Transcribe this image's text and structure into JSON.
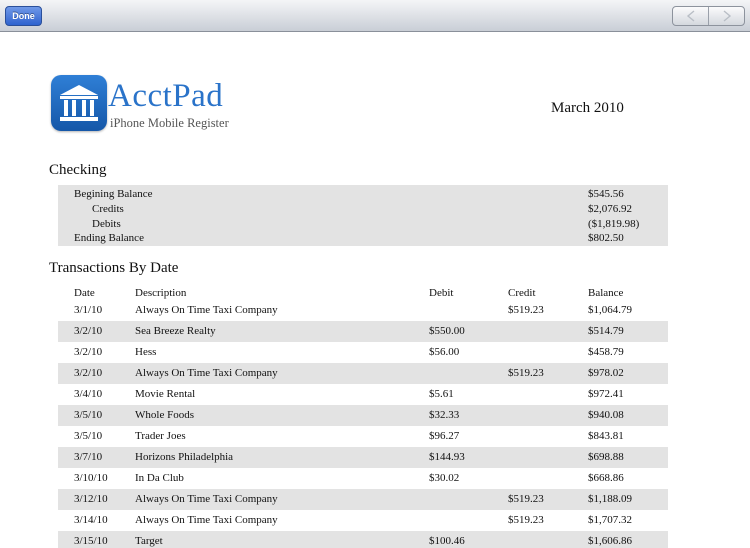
{
  "toolbar": {
    "done_label": "Done",
    "nav_prev_icon": "chevron-left-icon",
    "nav_next_icon": "chevron-right-icon"
  },
  "brand": {
    "name": "AcctPad",
    "tagline": "iPhone Mobile Register",
    "icon": "bank-building-icon",
    "accent": "#2a73c9"
  },
  "report": {
    "period": "March 2010"
  },
  "checking": {
    "title": "Checking",
    "rows": [
      {
        "label": "Begining Balance",
        "value": "$545.56"
      },
      {
        "label": "Credits",
        "value": "$2,076.92"
      },
      {
        "label": "Debits",
        "value": "($1,819.98)"
      },
      {
        "label": "Ending Balance",
        "value": "$802.50"
      }
    ]
  },
  "transactions": {
    "title": "Transactions By Date",
    "headers": {
      "date": "Date",
      "description": "Description",
      "debit": "Debit",
      "credit": "Credit",
      "balance": "Balance"
    },
    "rows": [
      {
        "date": "3/1/10",
        "description": "Always On Time Taxi Company",
        "debit": "",
        "credit": "$519.23",
        "balance": "$1,064.79"
      },
      {
        "date": "3/2/10",
        "description": "Sea Breeze Realty",
        "debit": "$550.00",
        "credit": "",
        "balance": "$514.79"
      },
      {
        "date": "3/2/10",
        "description": "Hess",
        "debit": "$56.00",
        "credit": "",
        "balance": "$458.79"
      },
      {
        "date": "3/2/10",
        "description": "Always On Time Taxi Company",
        "debit": "",
        "credit": "$519.23",
        "balance": "$978.02"
      },
      {
        "date": "3/4/10",
        "description": "Movie Rental",
        "debit": "$5.61",
        "credit": "",
        "balance": "$972.41"
      },
      {
        "date": "3/5/10",
        "description": "Whole Foods",
        "debit": "$32.33",
        "credit": "",
        "balance": "$940.08"
      },
      {
        "date": "3/5/10",
        "description": "Trader Joes",
        "debit": "$96.27",
        "credit": "",
        "balance": "$843.81"
      },
      {
        "date": "3/7/10",
        "description": "Horizons Philadelphia",
        "debit": "$144.93",
        "credit": "",
        "balance": "$698.88"
      },
      {
        "date": "3/10/10",
        "description": "In Da Club",
        "debit": "$30.02",
        "credit": "",
        "balance": "$668.86"
      },
      {
        "date": "3/12/10",
        "description": "Always On Time Taxi Company",
        "debit": "",
        "credit": "$519.23",
        "balance": "$1,188.09"
      },
      {
        "date": "3/14/10",
        "description": "Always On Time Taxi Company",
        "debit": "",
        "credit": "$519.23",
        "balance": "$1,707.32"
      },
      {
        "date": "3/15/10",
        "description": "Target",
        "debit": "$100.46",
        "credit": "",
        "balance": "$1,606.86"
      }
    ]
  }
}
